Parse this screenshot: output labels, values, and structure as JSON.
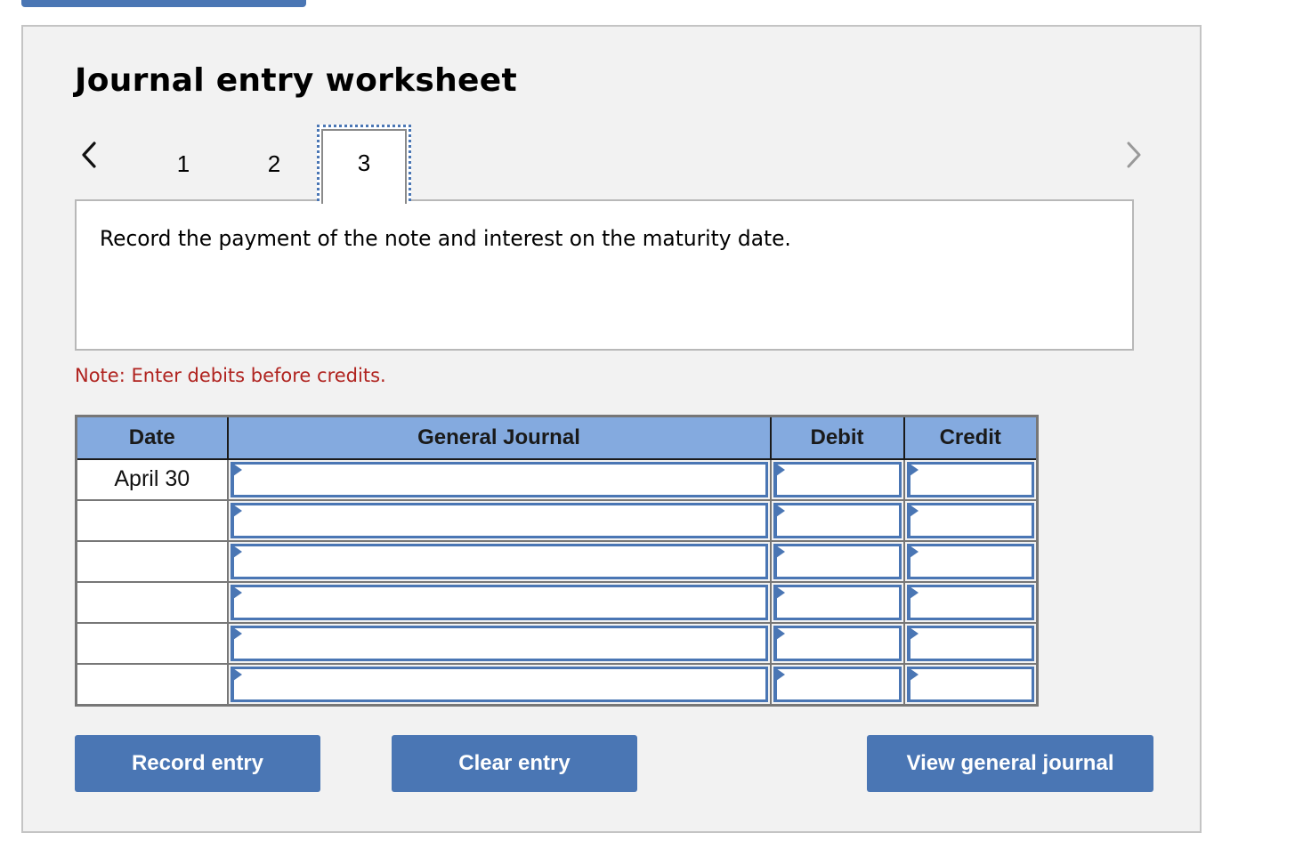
{
  "worksheet": {
    "title": "Journal entry worksheet",
    "steps": [
      {
        "label": "1",
        "active": false
      },
      {
        "label": "2",
        "active": false
      },
      {
        "label": "3",
        "active": true
      }
    ],
    "prev_icon": "chevron-left-icon",
    "next_icon": "chevron-right-icon",
    "prompt": "Record the payment of the note and interest on the maturity date.",
    "note": "Note: Enter debits before credits.",
    "colors": {
      "accent": "#4a76b4",
      "header_bg": "#84aadf",
      "note": "#b0231f",
      "panel_bg": "#f2f2f2"
    }
  },
  "table": {
    "headers": {
      "date": "Date",
      "general_journal": "General Journal",
      "debit": "Debit",
      "credit": "Credit"
    },
    "rows": [
      {
        "date": "April 30",
        "account": "",
        "debit": "",
        "credit": ""
      },
      {
        "date": "",
        "account": "",
        "debit": "",
        "credit": ""
      },
      {
        "date": "",
        "account": "",
        "debit": "",
        "credit": ""
      },
      {
        "date": "",
        "account": "",
        "debit": "",
        "credit": ""
      },
      {
        "date": "",
        "account": "",
        "debit": "",
        "credit": ""
      },
      {
        "date": "",
        "account": "",
        "debit": "",
        "credit": ""
      }
    ]
  },
  "buttons": {
    "record": "Record entry",
    "clear": "Clear entry",
    "view": "View general journal"
  }
}
